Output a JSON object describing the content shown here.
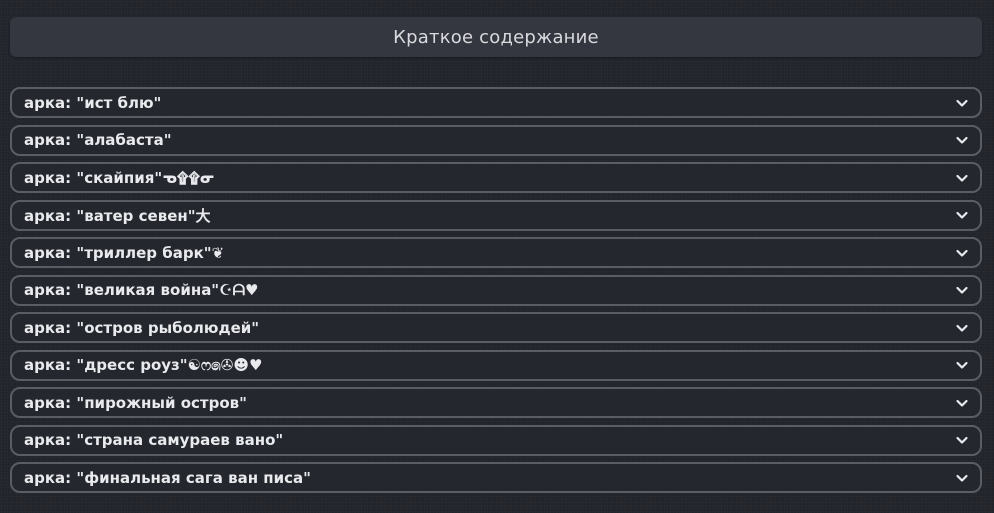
{
  "header": {
    "title": "Краткое содержание"
  },
  "arcs": [
    {
      "label": "арка: \"ист блю\""
    },
    {
      "label": "арка: \"алабаста\""
    },
    {
      "label": "арка: \"скайпия\"ᓀ۩۩ᓂ"
    },
    {
      "label": "арка: \"ватер севен\"大"
    },
    {
      "label": "арка: \"триллер барк\"❦"
    },
    {
      "label": "арка: \"великая война\"☪ᗩ♥"
    },
    {
      "label": "арка: \"остров рыболюдей\""
    },
    {
      "label": "арка: \"дресс роуз\"☯ෆ෧✇☻♥"
    },
    {
      "label": "арка: \"пирожный остров\""
    },
    {
      "label": "арка: \"страна самураев вано\""
    },
    {
      "label": "арка: \"финальная сага ван писа\""
    }
  ],
  "icons": {
    "expand": "chevron-down-icon"
  }
}
